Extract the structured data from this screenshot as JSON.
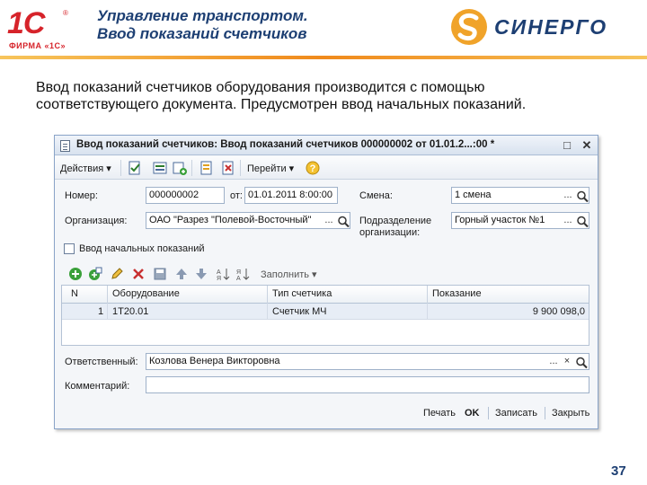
{
  "header": {
    "logo_1c_mark": "1С",
    "logo_1c_sub": "ФИРМА «1С»",
    "title_line1": "Управление транспортом.",
    "title_line2": "Ввод показаний счетчиков",
    "sinergo_text": "СИНЕРГО",
    "colors": {
      "title": "#1d3f73",
      "accent_rule": "#f08a1c",
      "logo_1c": "#d6232a"
    }
  },
  "slide": {
    "text_line1": "Ввод показаний счетчиков оборудования производится с помощью",
    "text_line2": "соответствующего документа. Предусмотрен ввод начальных показаний.",
    "page_number": "37"
  },
  "window": {
    "title": "Ввод показаний счетчиков: Ввод показаний счетчиков 000000002 от 01.01.2...:00 *",
    "controls": [
      "□",
      "✕"
    ],
    "toolbar": {
      "actions_label": "Действия ▾",
      "goto_label": "Перейти ▾",
      "icons": [
        "post-icon",
        "repost-icon",
        "add-copy-icon",
        "fill-icon",
        "unpost-icon",
        "structure-icon",
        "help-icon"
      ]
    },
    "form": {
      "number_label": "Номер:",
      "number_value": "000000002",
      "date_label": "от:",
      "date_value": "01.01.2011  8:00:00",
      "shift_label": "Смена:",
      "shift_value": "1 смена",
      "org_label": "Организация:",
      "org_value": "ОАО \"Разрез \"Полевой-Восточный\"",
      "division_label_1": "Подразделение",
      "division_label_2": "организации:",
      "division_value": "Горный участок №1",
      "initial_checkbox_label": "Ввод начальных показаний",
      "initial_checked": false,
      "fill_label": "Заполнить ▾",
      "select_button": "...",
      "search_button": "🔍",
      "clear_button": "×"
    },
    "table": {
      "columns": [
        "N",
        "Оборудование",
        "Тип счетчика",
        "Показание"
      ],
      "rows": [
        {
          "n": "1",
          "equipment": "1Т20.01",
          "meter_type": "Счетчик МЧ",
          "reading": "9 900 098,0"
        }
      ]
    },
    "responsible": {
      "label": "Ответственный:",
      "value": "Козлова Венера Викторовна"
    },
    "comment": {
      "label": "Комментарий:",
      "value": ""
    },
    "footer": {
      "print": "Печать",
      "ok": "OK",
      "save": "Записать",
      "close": "Закрыть"
    }
  }
}
